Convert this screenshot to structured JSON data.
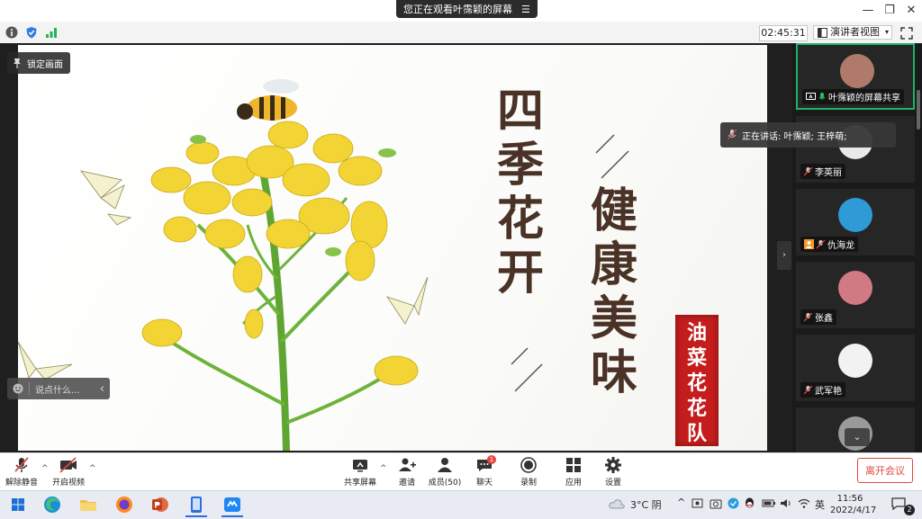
{
  "window": {
    "share_banner": "您正在观看叶霈颖的屏幕",
    "minimize_glyph": "—",
    "restore_glyph": "❐",
    "close_glyph": "✕"
  },
  "info_bar": {
    "timer": "02:45:31",
    "presenter_view": "演讲者视图",
    "icons": [
      "info-icon",
      "shield-icon",
      "signal-icon"
    ]
  },
  "stage": {
    "lock_label": "锁定画面",
    "chat_placeholder": "说点什么...",
    "chat_collapse": "‹",
    "panel_toggle": "›"
  },
  "slide": {
    "title_left": "四季花开",
    "title_right": "健康美味",
    "stamp": "油菜花花队"
  },
  "participants": {
    "speaking": "正在讲话: 叶霈颖; 王梓萌;",
    "tiles": [
      {
        "name": "叶霈颖的屏幕共享",
        "avatar_color": "#b07a6a",
        "active": true
      },
      {
        "name": "李英丽",
        "avatar_color": "#e9e9e9",
        "active": false
      },
      {
        "name": "仇海龙",
        "avatar_color": "#2e9ad6",
        "active": false
      },
      {
        "name": "张鑫",
        "avatar_color": "#d27a84",
        "active": false
      },
      {
        "name": "武军艳",
        "avatar_color": "#f2f2f2",
        "active": false
      },
      {
        "name": "",
        "avatar_color": "#9a9a9a",
        "active": false
      }
    ],
    "scroll_glyph": "⌄"
  },
  "toolbar": {
    "mute": "解除静音",
    "video": "开启视频",
    "share": "共享屏幕",
    "invite": "邀请",
    "members": "成员(50)",
    "chat": "聊天",
    "chat_badge": "1",
    "record": "录制",
    "apps": "应用",
    "settings": "设置",
    "leave": "离开会议",
    "caret": "^"
  },
  "taskbar": {
    "weather": "3°C 阴",
    "ime": "英",
    "time": "11:56",
    "date": "2022/4/17",
    "notifications": "2",
    "colors": {
      "accent": "#2d6fdc"
    }
  }
}
